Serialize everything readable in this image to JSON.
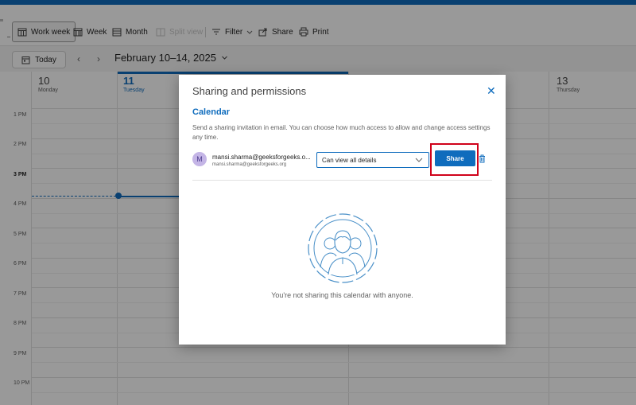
{
  "toolbar": {
    "work_week": "Work week",
    "week": "Week",
    "month": "Month",
    "split_view": "Split view",
    "filter": "Filter",
    "share": "Share",
    "print": "Print"
  },
  "nav": {
    "today": "Today",
    "date_range": "February 10–14, 2025"
  },
  "days": [
    {
      "num": "10",
      "name": "Monday",
      "today": false
    },
    {
      "num": "11",
      "name": "Tuesday",
      "today": true
    },
    {
      "num": "13",
      "name": "Thursday",
      "today": false
    }
  ],
  "times": [
    "1 PM",
    "2 PM",
    "3 PM",
    "4 PM",
    "5 PM",
    "6 PM",
    "7 PM",
    "8 PM",
    "9 PM",
    "10 PM"
  ],
  "colors": {
    "accent": "#0f6cbd",
    "highlight": "#d0021b",
    "avatar_bg": "#c4b5e6"
  },
  "dialog": {
    "title": "Sharing and permissions",
    "heading": "Calendar",
    "description": "Send a sharing invitation in email. You can choose how much access to allow and change access settings any time.",
    "user": {
      "initial": "M",
      "name": "mansi.sharma@geeksforgeeks.o...",
      "email": "mansi.sharma@geeksforgeeks.org"
    },
    "permission": "Can view all details",
    "share_button": "Share",
    "empty_text": "You're not sharing this calendar with anyone."
  }
}
